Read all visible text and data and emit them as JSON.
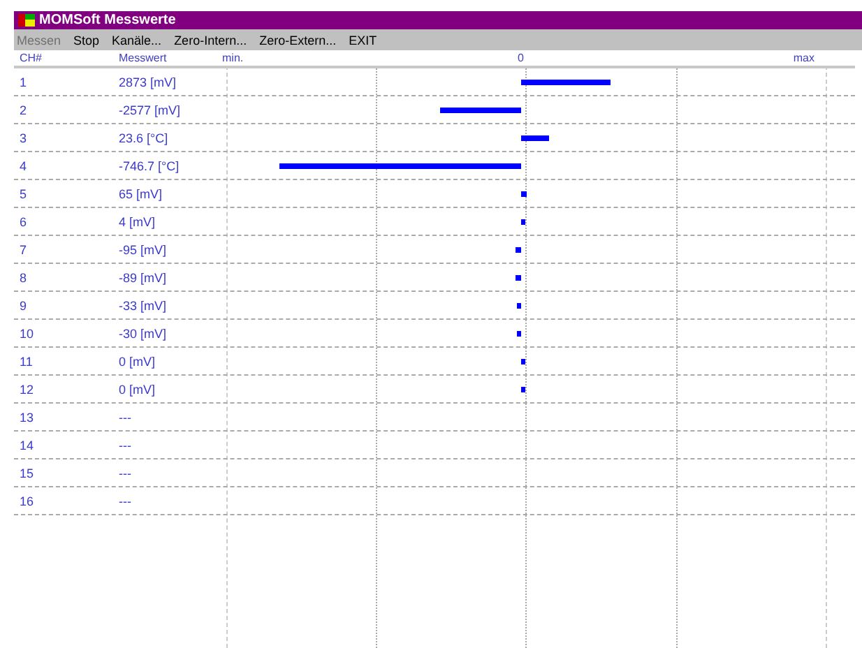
{
  "window": {
    "title": "MOMSoft Messwerte"
  },
  "menu": [
    {
      "label": "Messen",
      "disabled": true
    },
    {
      "label": "Stop",
      "disabled": false
    },
    {
      "label": "Kanäle...",
      "disabled": false
    },
    {
      "label": "Zero-Intern...",
      "disabled": false
    },
    {
      "label": "Zero-Extern...",
      "disabled": false
    },
    {
      "label": "EXIT",
      "disabled": false
    }
  ],
  "table": {
    "columns": [
      "CH#",
      "Messwert",
      "min.",
      "0",
      "max"
    ],
    "rows": [
      {
        "channel": "1",
        "value": "2873 [mV]"
      },
      {
        "channel": "2",
        "value": "-2577 [mV]"
      },
      {
        "channel": "3",
        "value": "23.6 [°C]"
      },
      {
        "channel": "4",
        "value": "-746.7 [°C]"
      },
      {
        "channel": "5",
        "value": "65 [mV]"
      },
      {
        "channel": "6",
        "value": "4 [mV]"
      },
      {
        "channel": "7",
        "value": "-95 [mV]"
      },
      {
        "channel": "8",
        "value": "-89 [mV]"
      },
      {
        "channel": "9",
        "value": "-33 [mV]"
      },
      {
        "channel": "10",
        "value": "-30 [mV]"
      },
      {
        "channel": "11",
        "value": "0 [mV]"
      },
      {
        "channel": "12",
        "value": "0 [mV]"
      },
      {
        "channel": "13",
        "value": "---"
      },
      {
        "channel": "14",
        "value": "---"
      },
      {
        "channel": "15",
        "value": "---"
      },
      {
        "channel": "16",
        "value": "---"
      }
    ]
  }
}
